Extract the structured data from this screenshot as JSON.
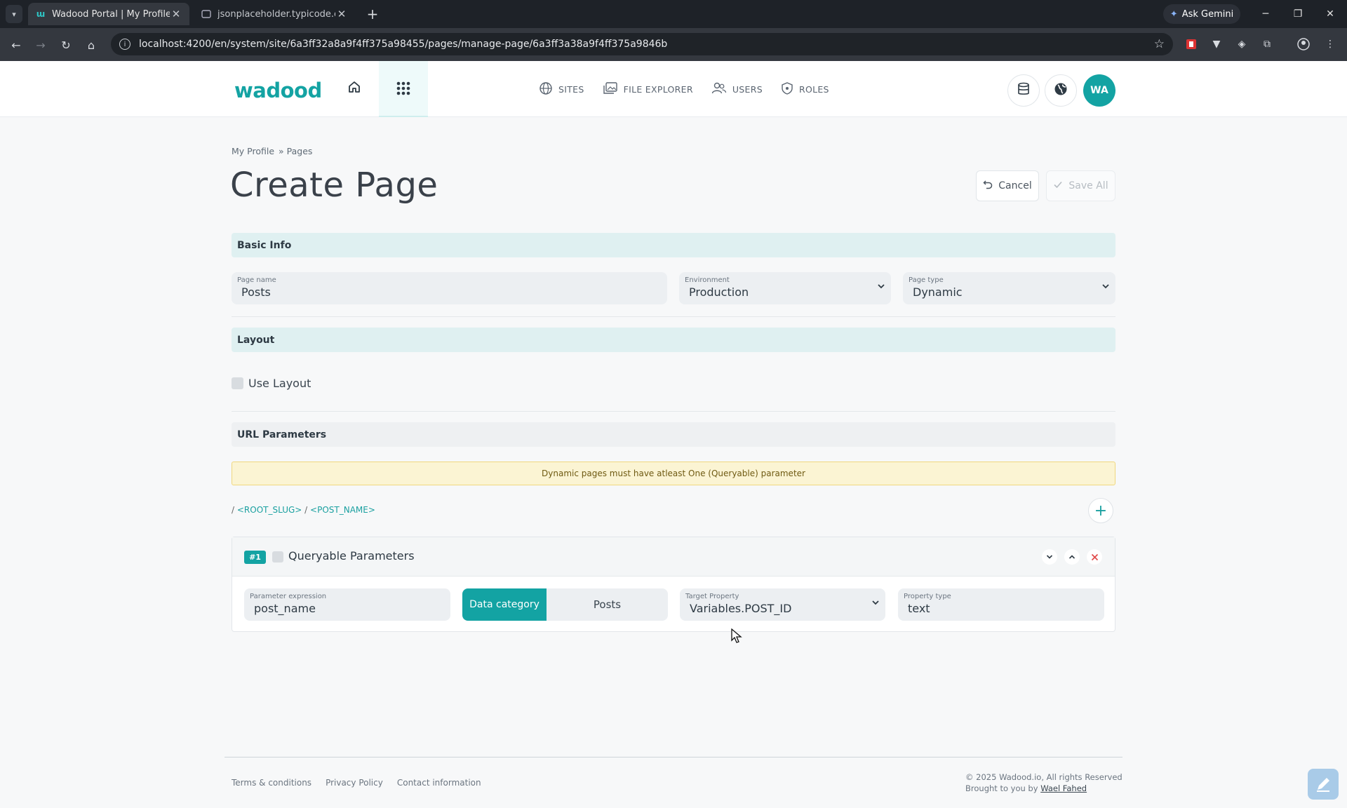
{
  "browser": {
    "tabs": [
      {
        "title": "Wadood Portal | My Profile - Cr",
        "active": true
      },
      {
        "title": "jsonplaceholder.typicode.com/p",
        "active": false
      }
    ],
    "gemini_label": "Ask Gemini",
    "url": "localhost:4200/en/system/site/6a3ff32a8a9f4ff375a98455/pages/manage-page/6a3ff3a38a9f4ff375a9846b"
  },
  "header": {
    "logo": "wadood",
    "nav": [
      {
        "label": "SITES",
        "icon": "globe-icon"
      },
      {
        "label": "FILE EXPLORER",
        "icon": "images-icon"
      },
      {
        "label": "USERS",
        "icon": "users-icon"
      },
      {
        "label": "ROLES",
        "icon": "shield-icon"
      }
    ],
    "avatar_initials": "WA",
    "accent": "#13a3a3"
  },
  "breadcrumb": [
    "My Profile",
    "» Pages"
  ],
  "page_title": "Create Page",
  "actions": {
    "cancel": "Cancel",
    "save": "Save All"
  },
  "sections": {
    "basic_info": "Basic Info",
    "layout": "Layout",
    "url_parameters": "URL Parameters"
  },
  "basic_info": {
    "page_name": {
      "label": "Page name",
      "value": "Posts"
    },
    "environment": {
      "label": "Environment",
      "value": "Production"
    },
    "page_type": {
      "label": "Page type",
      "value": "Dynamic"
    }
  },
  "layout": {
    "use_layout_label": "Use Layout",
    "checked": false
  },
  "alert_text": "Dynamic pages must have atleast One (Queryable) parameter",
  "slug": {
    "sep1": "/",
    "root": "<ROOT_SLUG>",
    "sep2": "/",
    "post": "<POST_NAME>"
  },
  "parameter": {
    "badge": "#1",
    "title": "Queryable Parameters",
    "expression": {
      "label": "Parameter expression",
      "value": "post_name"
    },
    "toggle": {
      "active": "Data category",
      "inactive": "Posts"
    },
    "target_property": {
      "label": "Target Property",
      "value": "Variables.POST_ID"
    },
    "property_type": {
      "label": "Property type",
      "value": "text"
    }
  },
  "footer": {
    "links": [
      "Terms & conditions",
      "Privacy Policy",
      "Contact information"
    ],
    "copyright": "© 2025 Wadood.io, All rights Reserved",
    "brought_by": "Brought to you by",
    "author": "Wael Fahed"
  }
}
